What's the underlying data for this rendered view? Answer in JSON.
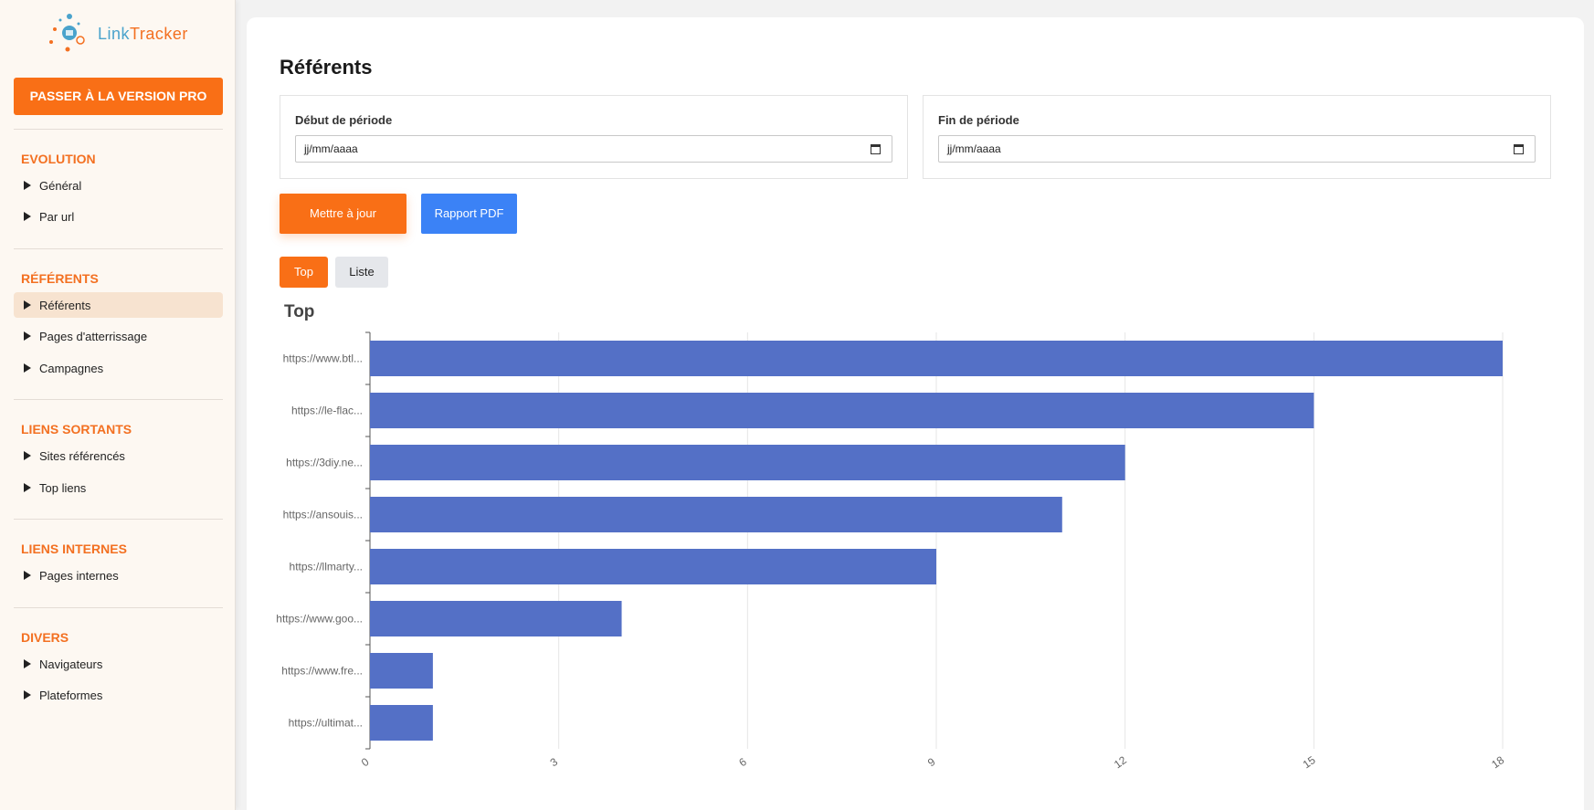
{
  "app": {
    "logo_part1": "Link",
    "logo_part2": "Tracker",
    "colors": {
      "accent": "#f96f16",
      "link_blue": "#4aa3cc",
      "primary": "#3b82f6",
      "bar": "#5470c6"
    }
  },
  "sidebar": {
    "pro_button": "PASSER À LA VERSION PRO",
    "sections": [
      {
        "title": "EVOLUTION",
        "items": [
          "Général",
          "Par url"
        ]
      },
      {
        "title": "RÉFÉRENTS",
        "items": [
          "Référents",
          "Pages d'atterrissage",
          "Campagnes"
        ]
      },
      {
        "title": "LIENS SORTANTS",
        "items": [
          "Sites référencés",
          "Top liens"
        ]
      },
      {
        "title": "LIENS INTERNES",
        "items": [
          "Pages internes"
        ]
      },
      {
        "title": "DIVERS",
        "items": [
          "Navigateurs",
          "Plateformes"
        ]
      }
    ],
    "active_item": "Référents"
  },
  "main": {
    "title": "Référents",
    "start_label": "Début de période",
    "start_placeholder": "jj/mm/aaaa",
    "end_label": "Fin de période",
    "end_placeholder": "jj/mm/aaaa",
    "update_button": "Mettre à jour",
    "pdf_button": "Rapport PDF",
    "tabs": [
      "Top",
      "Liste"
    ],
    "active_tab": "Top",
    "chart_heading": "Top"
  },
  "chart_data": {
    "type": "bar",
    "orientation": "horizontal",
    "categories": [
      "https://www.btl...",
      "https://le-flac...",
      "https://3diy.ne...",
      "https://ansouis...",
      "https://llmarty...",
      "https://www.goo...",
      "https://www.fre...",
      "https://ultimat..."
    ],
    "values": [
      18,
      15,
      12,
      11,
      9,
      4,
      1,
      1
    ],
    "xlim": [
      0,
      18
    ],
    "xticks": [
      0,
      3,
      6,
      9,
      12,
      15,
      18
    ],
    "grid": true,
    "color": "#5470c6"
  }
}
